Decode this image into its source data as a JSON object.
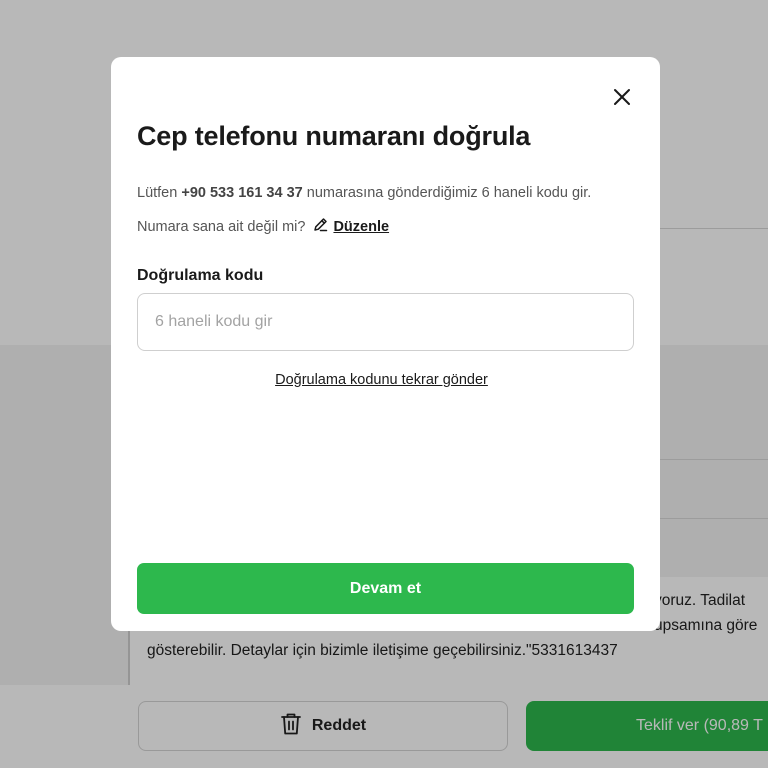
{
  "background": {
    "message_line1": "yoruz. Tadilat",
    "message_line2": "upsamına göre",
    "message_line3": "gösterebilir. Detaylar için bizimle iletişime geçebilirsiniz.\"5331613437",
    "reject_label": "Reddet",
    "offer_label": "Teklif ver (90,89 T",
    "accent_color": "#2db84d"
  },
  "modal": {
    "title": "Cep telefonu numaranı doğrula",
    "info_prefix": "Lütfen",
    "phone": "+90 533 161 34 37",
    "info_suffix": "numarasına gönderdiğimiz 6 haneli kodu gir.",
    "not_mine": "Numara sana ait değil mi?",
    "edit_label": "Düzenle",
    "code_label": "Doğrulama kodu",
    "code_placeholder": "6 haneli kodu gir",
    "code_value": "",
    "resend_label": "Doğrulama kodunu tekrar gönder",
    "continue_label": "Devam et"
  },
  "icons": {
    "close": "close-icon",
    "edit": "pencil-icon",
    "trash": "trash-icon"
  }
}
